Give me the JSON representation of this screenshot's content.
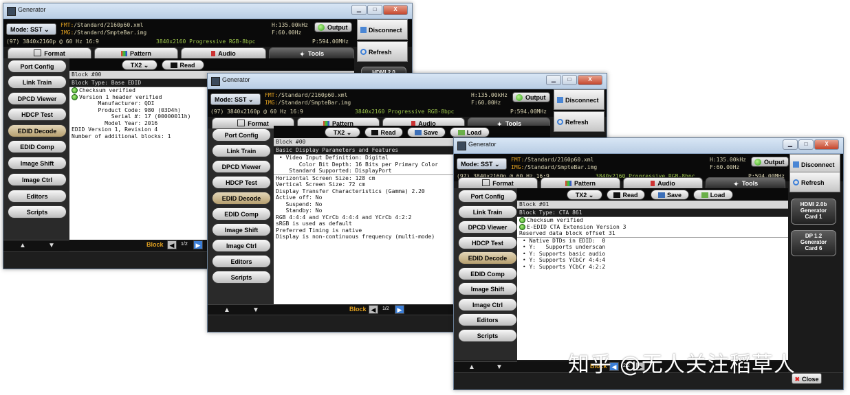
{
  "app": {
    "title": "Generator"
  },
  "window_buttons": {
    "minimize": "▁",
    "maximize": "□",
    "close": "X"
  },
  "info": {
    "mode": "Mode: SST",
    "fmt_key": "FMT:",
    "fmt_val": "/Standard/2160p60.xml",
    "img_key": "IMG:",
    "img_val": "/Standard/SmpteBar.img",
    "hfreq": "H:135.00kHz",
    "vfreq": "F:60.00Hz",
    "resolution_line": "(97) 3840x2160p @ 60 Hz 16:9",
    "timing": "3840x2160  Progressive  RGB-8bpc",
    "pixel_clock": "P:594.00MHz",
    "output_label": "Output",
    "disconnect_label": "Disconnect",
    "refresh_label": "Refresh"
  },
  "tabs": [
    "Format",
    "Pattern",
    "Audio",
    "Tools"
  ],
  "sidebar": [
    "Port Config",
    "Link Train",
    "DPCD Viewer",
    "HDCP Test",
    "EDID Decode",
    "EDID Comp",
    "Image Shift",
    "Image Ctrl",
    "Editors",
    "Scripts"
  ],
  "nav": {
    "up": "▲",
    "down": "▼"
  },
  "toolbar": {
    "tx": "TX2",
    "read": "Read",
    "save": "Save",
    "load": "Load"
  },
  "block_nav": {
    "label": "Block",
    "prev": "◀",
    "next": "▶"
  },
  "window1": {
    "block_num": "Block #00",
    "block_type": "Block Type: Base EDID",
    "lines": [
      "Checksum verified",
      "Version 1 header verified",
      "        Manufacturer: QDI",
      "        Product Code: 980 (03D4h)",
      "            Serial #: 17 (00000011h)",
      "          Model Year: 2016",
      "EDID Version 1, Revision 4",
      "Number of additional blocks: 1"
    ],
    "page": "1/2",
    "partial_card": "HDMI 2.0"
  },
  "window2": {
    "block_num": "Block #00",
    "section": "Basic Display Parameters and Features",
    "lines": [
      " • Video Input Definition: Digital",
      "       Color Bit Depth: 16 Bits per Primary Color",
      "    Standard Supported: DisplayPort",
      "Horizontal Screen Size: 128 cm",
      "Vertical Screen Size: 72 cm",
      "Display Transfer Characteristics (Gamma) 2.20",
      "Active off: No",
      "   Suspend: No",
      "   Standby: No",
      "RGB 4:4:4 and YCrCb 4:4:4 and YCrCb 4:2:2",
      "sRGB is used as default",
      "Preferred Timing is native",
      "Display is non-continuous frequency (multi-mode)"
    ],
    "page": "1/2"
  },
  "window3": {
    "block_num": "Block #01",
    "block_type": "Block Type: CTA 861",
    "lines": [
      "Checksum verified",
      "E-EDID CTA Extension Version 3",
      "Reserved data block offset 31",
      " • Native DTDs in EDID:  0",
      " • Y:   Supports underscan",
      " • Y: Supports basic audio",
      " • Y: Supports YCbCr 4:4:4",
      " • Y: Supports YCbCr 4:2:2"
    ],
    "cards": [
      {
        "line1": "HDMI 2.0b",
        "line2": "Generator",
        "line3": "Card 1"
      },
      {
        "line1": "DP 1.2",
        "line2": "Generator",
        "line3": "Card 6"
      }
    ],
    "page": "2/2",
    "close_label": "Close"
  },
  "watermark": "知乎 @无人关注稻草人",
  "colors": {
    "accent": "#e0a020",
    "ok_green": "#2d9a17",
    "active_blue": "#3c7fd8"
  }
}
